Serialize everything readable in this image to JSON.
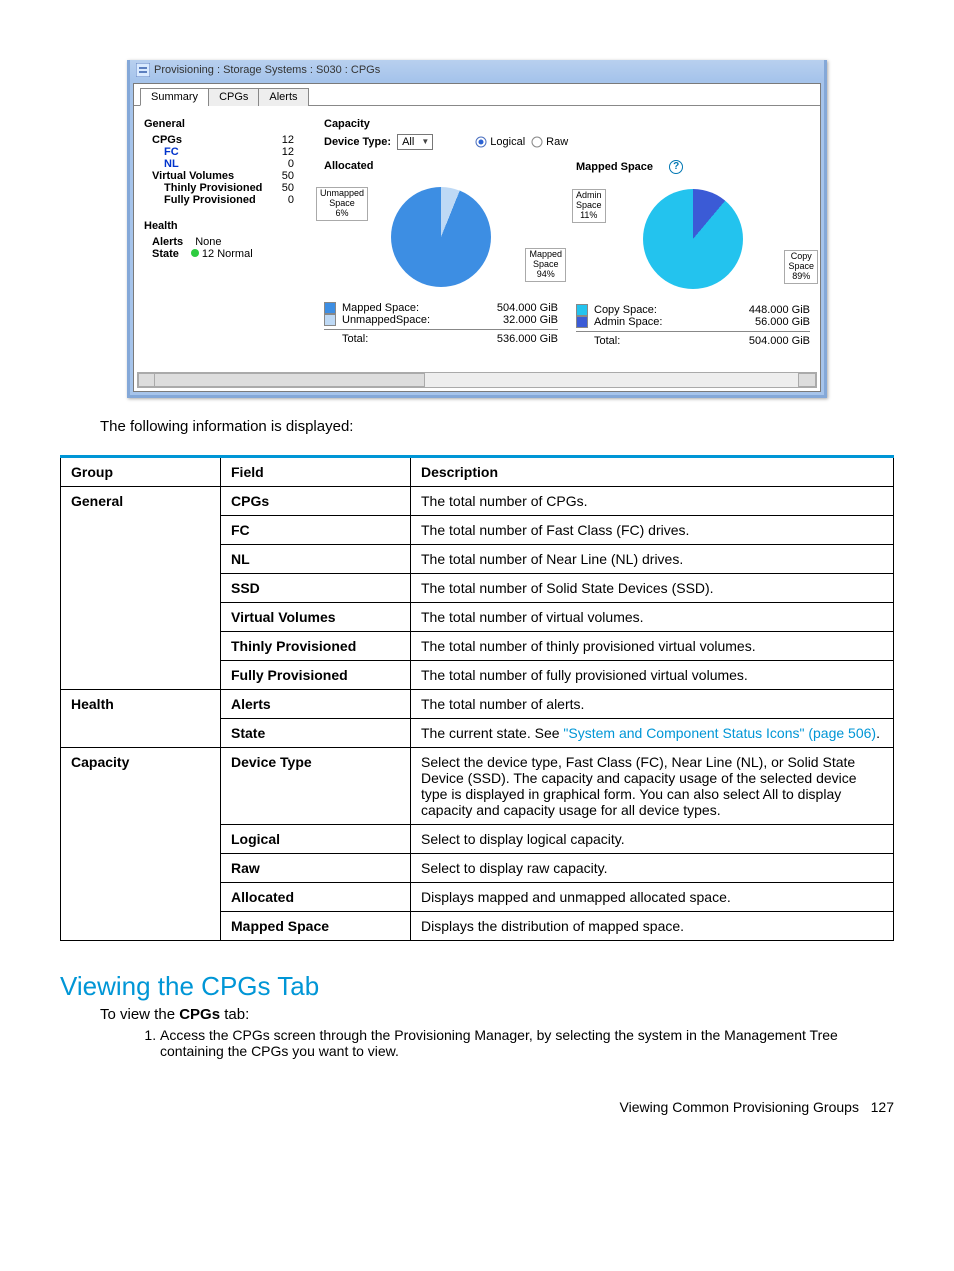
{
  "window": {
    "title_prefix": "Provisioning : Storage Systems : S030 : CPGs",
    "tabs": [
      "Summary",
      "CPGs",
      "Alerts"
    ],
    "active_tab_index": 0
  },
  "general": {
    "header": "General",
    "items": [
      {
        "label": "CPGs",
        "value": "12",
        "blue": false
      },
      {
        "label": "FC",
        "value": "12",
        "blue": true
      },
      {
        "label": "NL",
        "value": "0",
        "blue": true
      },
      {
        "label": "Virtual Volumes",
        "value": "50",
        "blue": false
      },
      {
        "label": "Thinly Provisioned",
        "value": "50",
        "blue": false
      },
      {
        "label": "Fully Provisioned",
        "value": "0",
        "blue": false
      }
    ]
  },
  "health": {
    "header": "Health",
    "alerts_label": "Alerts",
    "alerts_value": "None",
    "state_label": "State",
    "state_value": "12 Normal"
  },
  "capacity": {
    "header": "Capacity",
    "device_type_label": "Device Type:",
    "device_type_value": "All",
    "radio_logical": "Logical",
    "radio_raw": "Raw",
    "radio_selected": "logical",
    "allocated": {
      "title": "Allocated",
      "mapped_label": "Mapped Space:",
      "unmapped_label": "UnmappedSpace:",
      "total_label": "Total:",
      "mapped_value": "504.000 GiB",
      "unmapped_value": "32.000 GiB",
      "total_value": "536.000 GiB",
      "pie_lbl_unmapped": "Unmapped\nSpace\n6%",
      "pie_lbl_mapped": "Mapped\nSpace\n94%"
    },
    "mapped": {
      "title": "Mapped Space",
      "copy_label": "Copy Space:",
      "admin_label": "Admin Space:",
      "total_label": "Total:",
      "copy_value": "448.000 GiB",
      "admin_value": "56.000 GiB",
      "total_value": "504.000 GiB",
      "pie_lbl_admin": "Admin\nSpace\n11%",
      "pie_lbl_copy": "Copy\nSpace\n89%"
    }
  },
  "chart_data": [
    {
      "type": "pie",
      "title": "Allocated",
      "series": [
        {
          "name": "Mapped Space",
          "value": 504.0,
          "pct": 94,
          "color": "#3d8ee3"
        },
        {
          "name": "Unmapped Space",
          "value": 32.0,
          "pct": 6,
          "color": "#bed9f5"
        }
      ],
      "total": 536.0,
      "unit": "GiB"
    },
    {
      "type": "pie",
      "title": "Mapped Space",
      "series": [
        {
          "name": "Copy Space",
          "value": 448.0,
          "pct": 89,
          "color": "#23c3ee"
        },
        {
          "name": "Admin Space",
          "value": 56.0,
          "pct": 11,
          "color": "#3b5bd6"
        }
      ],
      "total": 504.0,
      "unit": "GiB"
    }
  ],
  "doc": {
    "intro": "The following information is displayed:",
    "table_headers": [
      "Group",
      "Field",
      "Description"
    ],
    "rows": [
      {
        "group": "General",
        "field": "CPGs",
        "desc": "The total number of CPGs."
      },
      {
        "group": "",
        "field": "FC",
        "desc": "The total number of Fast Class (FC) drives."
      },
      {
        "group": "",
        "field": "NL",
        "desc": "The total number of Near Line (NL) drives."
      },
      {
        "group": "",
        "field": "SSD",
        "desc": "The total number of Solid State Devices (SSD)."
      },
      {
        "group": "",
        "field": "Virtual Volumes",
        "desc": "The total number of virtual volumes."
      },
      {
        "group": "",
        "field": "Thinly Provisioned",
        "desc": "The total number of thinly provisioned virtual volumes."
      },
      {
        "group": "",
        "field": "Fully Provisioned",
        "desc": "The total number of fully provisioned virtual volumes."
      },
      {
        "group": "Health",
        "field": "Alerts",
        "desc": "The total number of alerts."
      },
      {
        "group": "",
        "field": "State",
        "desc": "The current state. See ",
        "link": "\"System and Component Status Icons\" (page 506)",
        "suffix": "."
      },
      {
        "group": "Capacity",
        "field": "Device Type",
        "desc": "Select the device type, Fast Class (FC), Near Line (NL), or Solid State Device (SSD). The capacity and capacity usage of the selected device type is displayed in graphical form. You can also select All to display capacity and capacity usage for all device types."
      },
      {
        "group": "",
        "field": "Logical",
        "desc": "Select to display logical capacity."
      },
      {
        "group": "",
        "field": "Raw",
        "desc": "Select to display raw capacity."
      },
      {
        "group": "",
        "field": "Allocated",
        "desc": "Displays mapped and unmapped allocated space."
      },
      {
        "group": "",
        "field": "Mapped Space",
        "desc": "Displays the distribution of mapped space."
      }
    ],
    "section_title": "Viewing the CPGs Tab",
    "section_intro_pre": "To view the ",
    "section_intro_bold": "CPGs",
    "section_intro_post": " tab:",
    "step1": "Access the CPGs screen through the Provisioning Manager, by selecting the system in the Management Tree containing the CPGs you want to view.",
    "footer": "Viewing Common Provisioning Groups",
    "page_number": "127"
  }
}
